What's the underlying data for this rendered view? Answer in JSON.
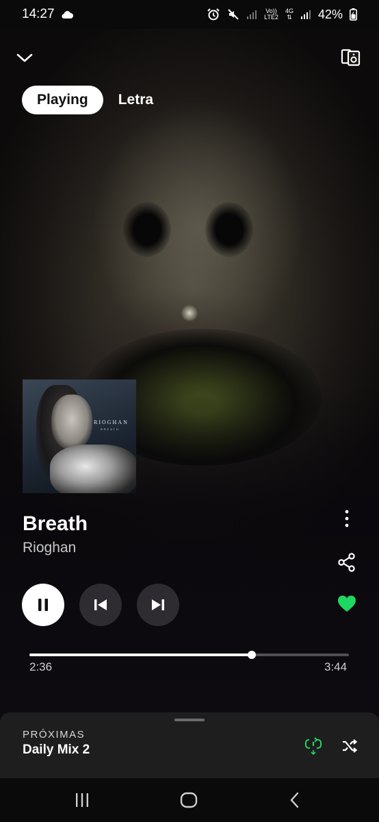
{
  "status_bar": {
    "time": "14:27",
    "network_top": "Vo))",
    "network_bottom": "LTE2",
    "network_type": "4G",
    "battery": "42%"
  },
  "tabs": [
    {
      "label": "Playing",
      "active": true
    },
    {
      "label": "Letra",
      "active": false
    }
  ],
  "album": {
    "brand": "RIOGHAN",
    "subtitle": "BREATH"
  },
  "track": {
    "title": "Breath",
    "artist": "Rioghan",
    "liked": true,
    "is_playing": true
  },
  "progress": {
    "elapsed": "2:36",
    "total": "3:44",
    "fraction": 0.696
  },
  "queue": {
    "label": "PRÓXIMAS",
    "name": "Daily Mix 2"
  },
  "colors": {
    "accent_green": "#1ed760",
    "sheet_bg": "#1e1e1e"
  },
  "icons": {
    "collapse": "chevron-down-icon",
    "devices": "devices-icon",
    "more": "more-vertical-icon",
    "share": "share-icon",
    "like": "heart-icon",
    "pause": "pause-icon",
    "previous": "skip-previous-icon",
    "next": "skip-next-icon",
    "repeat": "repeat-icon",
    "shuffle": "shuffle-icon"
  }
}
